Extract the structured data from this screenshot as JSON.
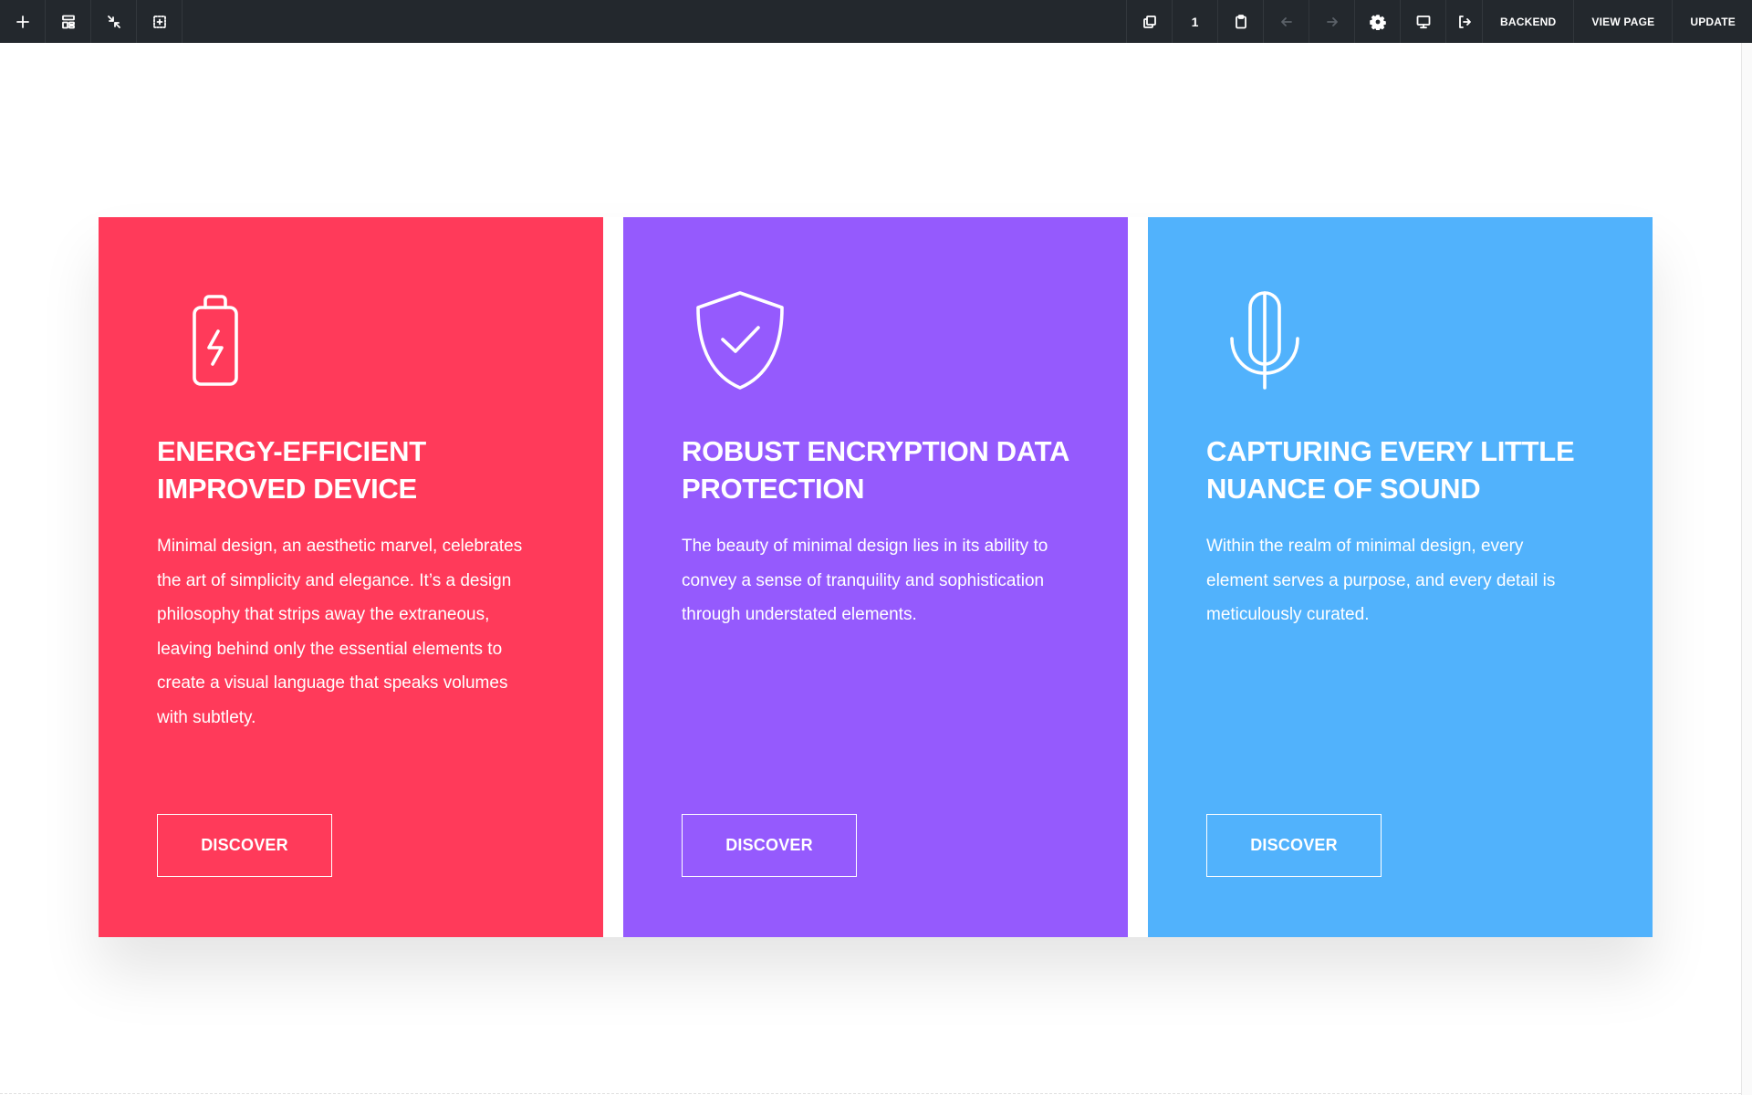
{
  "toolbar": {
    "left_icons": [
      "plus-icon",
      "layout-icon",
      "collapse-icon",
      "select-region-icon"
    ],
    "right": {
      "page_count": "1",
      "backend_label": "BACKEND",
      "view_page_label": "VIEW PAGE",
      "update_label": "UPDATE"
    }
  },
  "cards": [
    {
      "color": "#ff3a5a",
      "icon": "battery-icon",
      "title": "ENERGY-EFFICIENT IMPROVED DEVICE",
      "text": "Minimal design, an aesthetic marvel, celebrates the art of simplicity and elegance. It’s a design philosophy that strips away the extraneous, leaving behind only the essential elements to create a visual language that speaks volumes with subtlety.",
      "button": "DISCOVER"
    },
    {
      "color": "#955afd",
      "icon": "shield-check-icon",
      "title": "ROBUST ENCRYPTION DATA PROTECTION",
      "text": "The beauty of minimal design lies in its ability to convey a sense of tranquility and sophistication through understated elements.",
      "button": "DISCOVER"
    },
    {
      "color": "#51b2fc",
      "icon": "microphone-icon",
      "title": "CAPTURING EVERY LITTLE NUANCE OF SOUND",
      "text": "Within the realm of minimal design, every element serves a purpose, and every detail is meticulously curated.",
      "button": "DISCOVER"
    }
  ]
}
